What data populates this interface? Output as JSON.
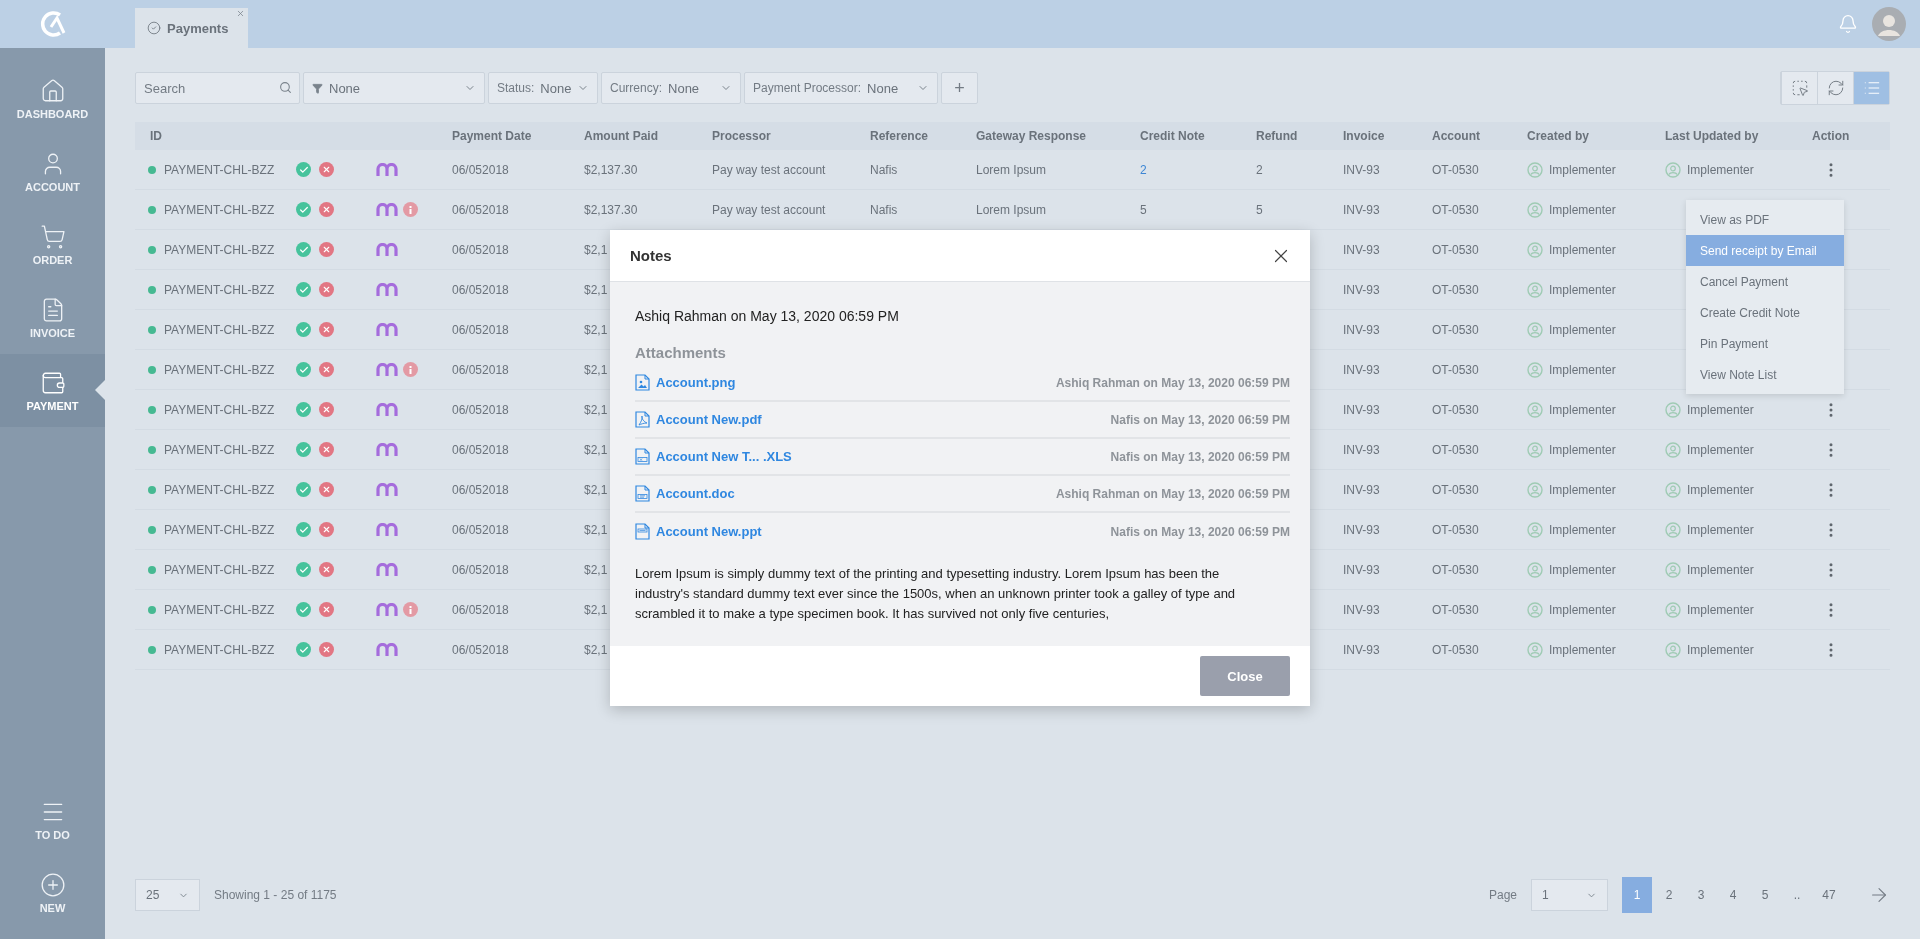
{
  "tab": {
    "label": "Payments"
  },
  "sidebar": {
    "items": [
      {
        "label": "DASHBOARD",
        "selected": false
      },
      {
        "label": "ACCOUNT",
        "selected": false
      },
      {
        "label": "ORDER",
        "selected": false
      },
      {
        "label": "INVOICE",
        "selected": false
      },
      {
        "label": "PAYMENT",
        "selected": true
      }
    ],
    "bottom_items": [
      {
        "label": "TO DO"
      },
      {
        "label": "NEW"
      }
    ]
  },
  "toolbar": {
    "search": {
      "placeholder": "Search"
    },
    "filter": {
      "value": "None"
    },
    "dropdowns": [
      {
        "label": "Status:",
        "value": "None"
      },
      {
        "label": "Currency:",
        "value": "None"
      },
      {
        "label": "Payment Processor:",
        "value": "None"
      }
    ],
    "add_button": "+",
    "view_buttons": [
      {
        "selected": false
      },
      {
        "selected": false
      },
      {
        "selected": true
      }
    ]
  },
  "table": {
    "columns": [
      "ID",
      "",
      "Payment Date",
      "Amount Paid",
      "Processor",
      "Reference",
      "Gateway Response",
      "Credit Note",
      "Refund",
      "Invoice",
      "Account",
      "Created by",
      "Last Updated by",
      "Action"
    ],
    "rows": [
      {
        "id": "PAYMENT-CHL-BZZ",
        "info": false,
        "date": "06/052018",
        "amount": "$2,137.30",
        "processor": "Pay way test account",
        "reference": "Nafis",
        "gateway_response": "Lorem Ipsum",
        "credit_note": "2",
        "credit_note_link": true,
        "refund": "2",
        "invoice": "INV-93",
        "account": "OT-0530",
        "created_by": "Implementer",
        "last_updated_by": "Implementer"
      },
      {
        "id": "PAYMENT-CHL-BZZ",
        "info": true,
        "date": "06/052018",
        "amount": "$2,137.30",
        "processor": "Pay way test account",
        "reference": "Nafis",
        "gateway_response": "Lorem Ipsum",
        "credit_note": "5",
        "credit_note_link": false,
        "refund": "5",
        "invoice": "INV-93",
        "account": "OT-0530",
        "created_by": "Implementer"
      },
      {
        "id": "PAYMENT-CHL-BZZ",
        "info": false,
        "date": "06/052018",
        "amount": "$2,1",
        "invoice": "INV-93",
        "account": "OT-0530",
        "created_by": "Implementer"
      },
      {
        "id": "PAYMENT-CHL-BZZ",
        "info": false,
        "date": "06/052018",
        "amount": "$2,1",
        "invoice": "INV-93",
        "account": "OT-0530",
        "created_by": "Implementer"
      },
      {
        "id": "PAYMENT-CHL-BZZ",
        "info": false,
        "date": "06/052018",
        "amount": "$2,1",
        "invoice": "INV-93",
        "account": "OT-0530",
        "created_by": "Implementer"
      },
      {
        "id": "PAYMENT-CHL-BZZ",
        "info": true,
        "date": "06/052018",
        "amount": "$2,1",
        "invoice": "INV-93",
        "account": "OT-0530",
        "created_by": "Implementer"
      },
      {
        "id": "PAYMENT-CHL-BZZ",
        "info": false,
        "date": "06/052018",
        "amount": "$2,1",
        "invoice": "INV-93",
        "account": "OT-0530",
        "created_by": "Implementer",
        "last_updated_by": "Implementer"
      },
      {
        "id": "PAYMENT-CHL-BZZ",
        "info": false,
        "date": "06/052018",
        "amount": "$2,1",
        "invoice": "INV-93",
        "account": "OT-0530",
        "created_by": "Implementer",
        "last_updated_by": "Implementer"
      },
      {
        "id": "PAYMENT-CHL-BZZ",
        "info": false,
        "date": "06/052018",
        "amount": "$2,1",
        "invoice": "INV-93",
        "account": "OT-0530",
        "created_by": "Implementer",
        "last_updated_by": "Implementer"
      },
      {
        "id": "PAYMENT-CHL-BZZ",
        "info": false,
        "date": "06/052018",
        "amount": "$2,1",
        "invoice": "INV-93",
        "account": "OT-0530",
        "created_by": "Implementer",
        "last_updated_by": "Implementer"
      },
      {
        "id": "PAYMENT-CHL-BZZ",
        "info": false,
        "date": "06/052018",
        "amount": "$2,1",
        "invoice": "INV-93",
        "account": "OT-0530",
        "created_by": "Implementer",
        "last_updated_by": "Implementer"
      },
      {
        "id": "PAYMENT-CHL-BZZ",
        "info": true,
        "date": "06/052018",
        "amount": "$2,1",
        "invoice": "INV-93",
        "account": "OT-0530",
        "created_by": "Implementer",
        "last_updated_by": "Implementer"
      },
      {
        "id": "PAYMENT-CHL-BZZ",
        "info": false,
        "date": "06/052018",
        "amount": "$2,1",
        "invoice": "INV-93",
        "account": "OT-0530",
        "created_by": "Implementer",
        "last_updated_by": "Implementer"
      }
    ]
  },
  "action_menu": {
    "items": [
      {
        "label": "View as PDF",
        "selected": false
      },
      {
        "label": "Send receipt by Email",
        "selected": true
      },
      {
        "label": "Cancel Payment",
        "selected": false
      },
      {
        "label": "Create Credit Note",
        "selected": false
      },
      {
        "label": "Pin Payment",
        "selected": false
      },
      {
        "label": "View Note List",
        "selected": false
      }
    ]
  },
  "pagination": {
    "page_size": "25",
    "summary": "Showing 1 - 25 of 1175",
    "page_label": "Page",
    "page_value": "1",
    "pages": [
      {
        "label": "1",
        "selected": true
      },
      {
        "label": "2",
        "selected": false
      },
      {
        "label": "3",
        "selected": false
      },
      {
        "label": "4",
        "selected": false
      },
      {
        "label": "5",
        "selected": false
      },
      {
        "label": "..",
        "selected": false
      },
      {
        "label": "47",
        "selected": false
      }
    ]
  },
  "modal": {
    "title": "Notes",
    "author_line": "Ashiq Rahman on May 13, 2020 06:59 PM",
    "attachments_heading": "Attachments",
    "attachments": [
      {
        "kind": "image",
        "name": "Account.png",
        "meta": "Ashiq Rahman on May 13, 2020 06:59 PM"
      },
      {
        "kind": "pdf",
        "name": "Account New.pdf",
        "meta": "Nafis on May 13, 2020 06:59 PM"
      },
      {
        "kind": "xls",
        "name": "Account New T... .XLS",
        "meta": "Nafis on May 13, 2020 06:59 PM"
      },
      {
        "kind": "doc",
        "name": "Account.doc",
        "meta": "Ashiq Rahman on May 13, 2020 06:59 PM"
      },
      {
        "kind": "ppt",
        "name": "Account New.ppt",
        "meta": "Nafis on May 13, 2020 06:59 PM"
      }
    ],
    "text": "Lorem Ipsum is simply dummy text of the printing and typesetting industry. Lorem Ipsum has been the industry's standard dummy text ever since the 1500s, when an unknown printer took a galley of type and scrambled it to make a type specimen book. It has survived not only five centuries,",
    "close_button": "Close"
  }
}
